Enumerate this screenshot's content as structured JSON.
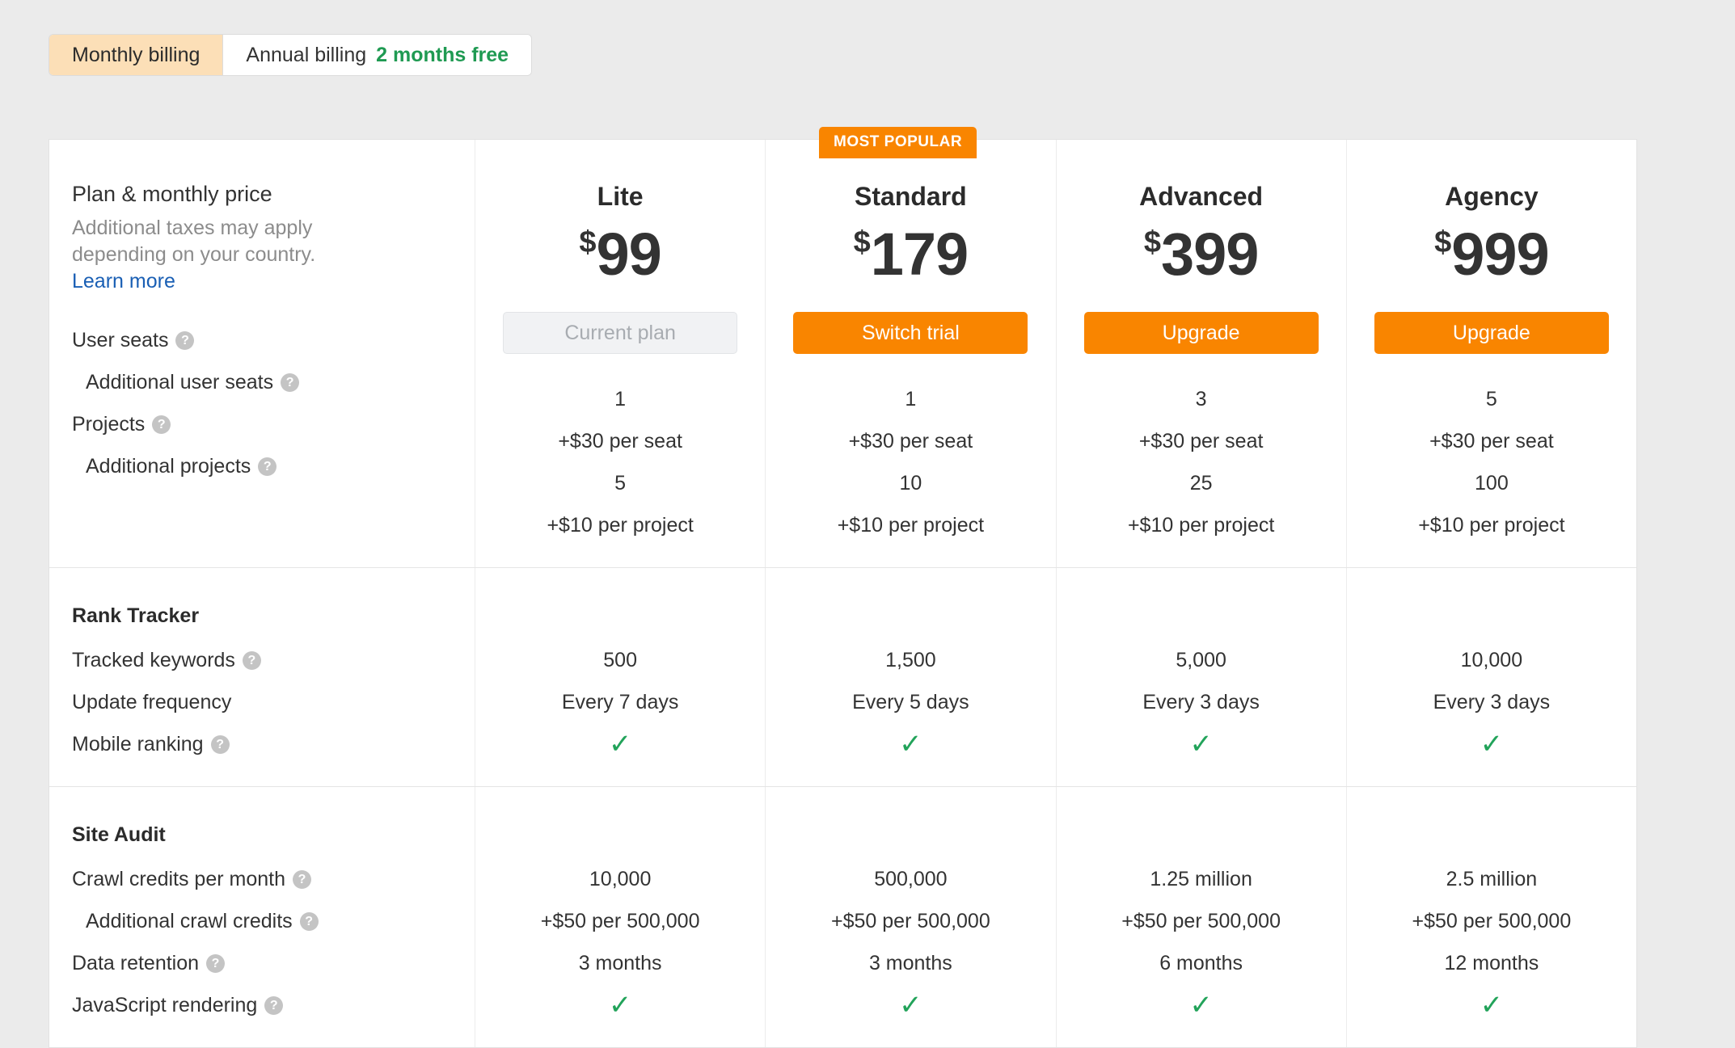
{
  "billing": {
    "monthly_label": "Monthly billing",
    "annual_label": "Annual billing",
    "annual_promo": "2 months free",
    "active": "monthly"
  },
  "badge": {
    "most_popular": "MOST POPULAR"
  },
  "intro": {
    "title": "Plan & monthly price",
    "subtitle": "Additional taxes may apply depending on your country.",
    "link": "Learn more"
  },
  "colors": {
    "accent": "#f98500",
    "promo_green": "#1f9a52",
    "check_green": "#22a35a",
    "link_blue": "#1a5fb4",
    "toggle_active_bg": "#fcdfb7",
    "page_bg": "#ebebeb"
  },
  "currency": "$",
  "plans": [
    {
      "name": "Lite",
      "price": "99",
      "cta": "Current plan",
      "cta_state": "disabled"
    },
    {
      "name": "Standard",
      "price": "179",
      "cta": "Switch trial",
      "cta_state": "primary"
    },
    {
      "name": "Advanced",
      "price": "399",
      "cta": "Upgrade",
      "cta_state": "primary"
    },
    {
      "name": "Agency",
      "price": "999",
      "cta": "Upgrade",
      "cta_state": "primary"
    }
  ],
  "header_features": [
    {
      "label": "User seats",
      "help": true,
      "indent": false,
      "values": [
        "1",
        "1",
        "3",
        "5"
      ]
    },
    {
      "label": "Additional user seats",
      "help": true,
      "indent": true,
      "values": [
        "+$30 per seat",
        "+$30 per seat",
        "+$30 per seat",
        "+$30 per seat"
      ]
    },
    {
      "label": "Projects",
      "help": true,
      "indent": false,
      "values": [
        "5",
        "10",
        "25",
        "100"
      ]
    },
    {
      "label": "Additional projects",
      "help": true,
      "indent": true,
      "values": [
        "+$10 per project",
        "+$10 per project",
        "+$10 per project",
        "+$10 per project"
      ]
    }
  ],
  "groups": [
    {
      "title": "Rank Tracker",
      "features": [
        {
          "label": "Tracked keywords",
          "help": true,
          "indent": false,
          "values": [
            "500",
            "1,500",
            "5,000",
            "10,000"
          ]
        },
        {
          "label": "Update frequency",
          "help": false,
          "indent": false,
          "values": [
            "Every 7 days",
            "Every 5 days",
            "Every 3 days",
            "Every 3 days"
          ]
        },
        {
          "label": "Mobile ranking",
          "help": true,
          "indent": false,
          "values": [
            "check",
            "check",
            "check",
            "check"
          ]
        }
      ]
    },
    {
      "title": "Site Audit",
      "features": [
        {
          "label": "Crawl credits per month",
          "help": true,
          "indent": false,
          "values": [
            "10,000",
            "500,000",
            "1.25 million",
            "2.5 million"
          ]
        },
        {
          "label": "Additional crawl credits",
          "help": true,
          "indent": true,
          "values": [
            "+$50 per 500,000",
            "+$50 per 500,000",
            "+$50 per 500,000",
            "+$50 per 500,000"
          ]
        },
        {
          "label": "Data retention",
          "help": true,
          "indent": false,
          "values": [
            "3 months",
            "3 months",
            "6 months",
            "12 months"
          ]
        },
        {
          "label": "JavaScript rendering",
          "help": true,
          "indent": false,
          "values": [
            "check",
            "check",
            "check",
            "check"
          ]
        }
      ]
    }
  ],
  "help_glyph": "?",
  "check_glyph": "✓"
}
